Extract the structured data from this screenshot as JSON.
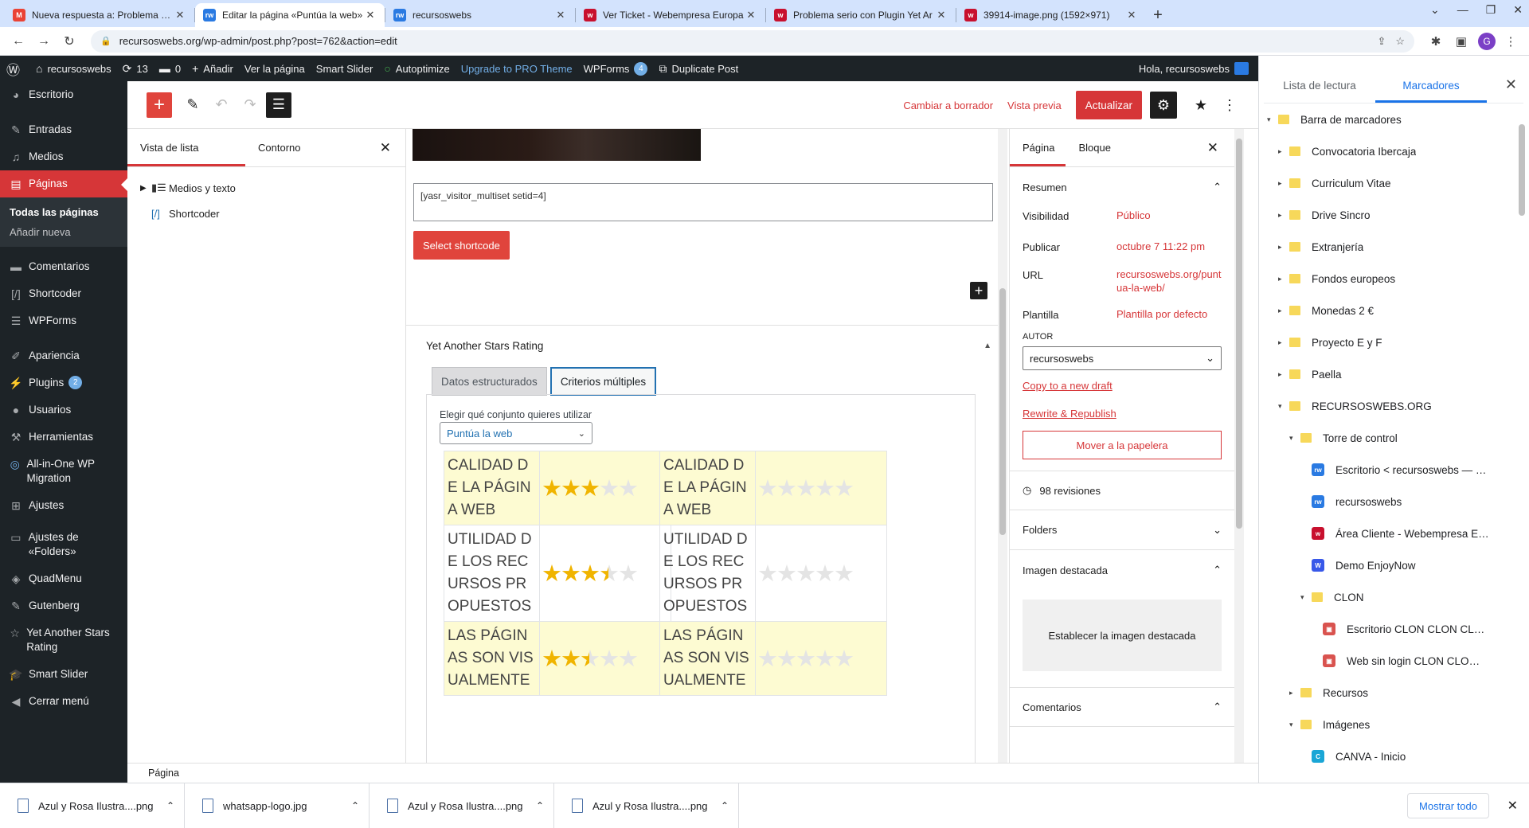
{
  "browser": {
    "tabs": [
      {
        "label": "Nueva respuesta a: Problema ser",
        "fav": "gmail-icon",
        "color": "#ea4335",
        "glyph": "M"
      },
      {
        "label": "Editar la página «Puntúa la web»",
        "fav": "rw-icon",
        "color": "#2a7ae2",
        "glyph": "rw",
        "active": true
      },
      {
        "label": "recursoswebs",
        "fav": "rw-icon",
        "color": "#2a7ae2",
        "glyph": "rw"
      },
      {
        "label": "Ver Ticket - Webempresa Europa",
        "fav": "webempresa-icon",
        "color": "#c8102e",
        "glyph": "w"
      },
      {
        "label": "Problema serio con Plugin Yet Ar",
        "fav": "wordpress-support-icon",
        "color": "#c8102e",
        "glyph": "w"
      },
      {
        "label": "39914-image.png (1592×971)",
        "fav": "webempresa-icon",
        "color": "#c8102e",
        "glyph": "w"
      }
    ],
    "url": "recursoswebs.org/wp-admin/post.php?post=762&action=edit",
    "profile_initial": "G"
  },
  "adminbar": {
    "site": "recursoswebs",
    "updates": "13",
    "comments": "0",
    "add_new": "Añadir",
    "view_page": "Ver la página",
    "smart_slider": "Smart Slider",
    "autoptimize": "Autoptimize",
    "upgrade": "Upgrade to PRO Theme",
    "wpforms": "WPForms",
    "wpforms_count": "4",
    "duplicate": "Duplicate Post",
    "greeting": "Hola, recursoswebs"
  },
  "menu": {
    "escritorio": "Escritorio",
    "entradas": "Entradas",
    "medios": "Medios",
    "paginas": "Páginas",
    "todas": "Todas las páginas",
    "anadir": "Añadir nueva",
    "comentarios": "Comentarios",
    "shortcoder": "Shortcoder",
    "wpforms": "WPForms",
    "apariencia": "Apariencia",
    "plugins": "Plugins",
    "plugins_count": "2",
    "usuarios": "Usuarios",
    "herramientas": "Herramientas",
    "aio": "All-in-One WP Migration",
    "ajustes": "Ajustes",
    "ajustes_folders": "Ajustes de «Folders»",
    "quadmenu": "QuadMenu",
    "gutenberg": "Gutenberg",
    "yasr": "Yet Another Stars Rating",
    "smartslider": "Smart Slider",
    "cerrar": "Cerrar menú"
  },
  "editor": {
    "cambiar_borrador": "Cambiar a borrador",
    "vista_previa": "Vista previa",
    "actualizar": "Actualizar",
    "status": "Página"
  },
  "listview": {
    "tab_list": "Vista de lista",
    "tab_outline": "Contorno",
    "items": [
      "Medios y texto",
      "Shortcoder"
    ]
  },
  "canvas": {
    "shortcode": "[yasr_visitor_multiset setid=4]",
    "select_shortcode": "Select shortcode",
    "metabox_title": "Yet Another Stars Rating",
    "tab_structured": "Datos estructurados",
    "tab_multi": "Criterios múltiples",
    "choose_label": "Elegir qué conjunto quieres utilizar",
    "set_selected": "Puntúa la web",
    "criteria": [
      {
        "name": "CALIDAD DE LA PÁGINA WEB",
        "left_rating": 3,
        "right_rating": 0
      },
      {
        "name": "UTILIDAD DE LOS RECURSOS PROPUESTOS",
        "left_rating": 3.5,
        "right_rating": 0
      },
      {
        "name": "LAS PÁGINAS SON VISUALMENTE",
        "left_rating": 2.5,
        "right_rating": 0
      }
    ]
  },
  "settings": {
    "tab_page": "Página",
    "tab_block": "Bloque",
    "resumen": "Resumen",
    "visibilidad_k": "Visibilidad",
    "visibilidad_v": "Público",
    "publicar_k": "Publicar",
    "publicar_v": "octubre 7 11:22 pm",
    "url_k": "URL",
    "url_v": "recursoswebs.org/puntua-la-web/",
    "plantilla_k": "Plantilla",
    "plantilla_v": "Plantilla por defecto",
    "autor_label": "AUTOR",
    "autor_v": "recursoswebs",
    "copy_draft": "Copy to a new draft",
    "rewrite": "Rewrite & Republish",
    "trash": "Mover a la papelera",
    "revisions": "98 revisiones",
    "folders": "Folders",
    "imagen": "Imagen destacada",
    "set_image": "Establecer la imagen destacada",
    "comentarios": "Comentarios"
  },
  "bookmarks": {
    "tab_reading": "Lista de lectura",
    "tab_bookmarks": "Marcadores",
    "items": [
      {
        "label": "Barra de marcadores",
        "indent": 0,
        "type": "folder",
        "open": true
      },
      {
        "label": "Convocatoria Ibercaja",
        "indent": 1,
        "type": "folder"
      },
      {
        "label": "Curriculum Vitae",
        "indent": 1,
        "type": "folder"
      },
      {
        "label": "Drive Sincro",
        "indent": 1,
        "type": "folder"
      },
      {
        "label": "Extranjería",
        "indent": 1,
        "type": "folder"
      },
      {
        "label": "Fondos europeos",
        "indent": 1,
        "type": "folder"
      },
      {
        "label": "Monedas 2 €",
        "indent": 1,
        "type": "folder"
      },
      {
        "label": "Proyecto E y F",
        "indent": 1,
        "type": "folder"
      },
      {
        "label": "Paella",
        "indent": 1,
        "type": "folder"
      },
      {
        "label": "RECURSOSWEBS.ORG",
        "indent": 1,
        "type": "folder",
        "open": true
      },
      {
        "label": "Torre de control",
        "indent": 2,
        "type": "folder",
        "open": true
      },
      {
        "label": "Escritorio < recursoswebs — …",
        "indent": 3,
        "type": "link",
        "color": "#2a7ae2",
        "glyph": "rw"
      },
      {
        "label": "recursoswebs",
        "indent": 3,
        "type": "link",
        "color": "#2a7ae2",
        "glyph": "rw"
      },
      {
        "label": "Área Cliente - Webempresa E…",
        "indent": 3,
        "type": "link",
        "color": "#c8102e",
        "glyph": "w"
      },
      {
        "label": "Demo EnjoyNow",
        "indent": 3,
        "type": "link",
        "color": "#3858e9",
        "glyph": "W"
      },
      {
        "label": "CLON",
        "indent": 3,
        "type": "folder",
        "open": true
      },
      {
        "label": "Escritorio CLON CLON CL…",
        "indent": 4,
        "type": "link",
        "color": "#d9534f",
        "glyph": "▣"
      },
      {
        "label": "Web sin login CLON CLO…",
        "indent": 4,
        "type": "link",
        "color": "#d9534f",
        "glyph": "▣"
      },
      {
        "label": "Recursos",
        "indent": 2,
        "type": "folder"
      },
      {
        "label": "Imágenes",
        "indent": 2,
        "type": "folder",
        "open": true
      },
      {
        "label": "CANVA - Inicio",
        "indent": 3,
        "type": "link",
        "color": "#1aa6d6",
        "glyph": "C"
      }
    ]
  },
  "downloads": {
    "items": [
      "Azul y Rosa Ilustra....png",
      "whatsapp-logo.jpg",
      "Azul y Rosa Ilustra....png",
      "Azul y Rosa Ilustra....png"
    ],
    "show_all": "Mostrar todo"
  }
}
